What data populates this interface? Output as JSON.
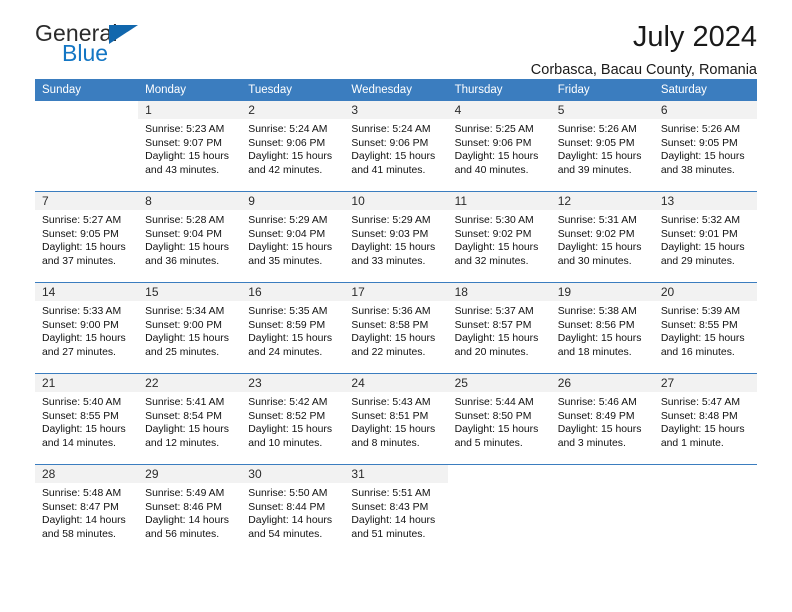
{
  "logo": {
    "word1": "General",
    "word2": "Blue",
    "triangle_color": "#1167ad",
    "blue_color": "#1376c4"
  },
  "header": {
    "title": "July 2024",
    "subtitle": "Corbasca, Bacau County, Romania"
  },
  "theme": {
    "header_bg": "#3b7dbf",
    "daynum_bg": "#f2f2f2",
    "grid_line": "#3b7dbf"
  },
  "weekdays": [
    "Sunday",
    "Monday",
    "Tuesday",
    "Wednesday",
    "Thursday",
    "Friday",
    "Saturday"
  ],
  "weeks": [
    [
      {
        "day": "",
        "sunrise": "",
        "sunset": "",
        "daylight1": "",
        "daylight2": ""
      },
      {
        "day": "1",
        "sunrise": "Sunrise: 5:23 AM",
        "sunset": "Sunset: 9:07 PM",
        "daylight1": "Daylight: 15 hours",
        "daylight2": "and 43 minutes."
      },
      {
        "day": "2",
        "sunrise": "Sunrise: 5:24 AM",
        "sunset": "Sunset: 9:06 PM",
        "daylight1": "Daylight: 15 hours",
        "daylight2": "and 42 minutes."
      },
      {
        "day": "3",
        "sunrise": "Sunrise: 5:24 AM",
        "sunset": "Sunset: 9:06 PM",
        "daylight1": "Daylight: 15 hours",
        "daylight2": "and 41 minutes."
      },
      {
        "day": "4",
        "sunrise": "Sunrise: 5:25 AM",
        "sunset": "Sunset: 9:06 PM",
        "daylight1": "Daylight: 15 hours",
        "daylight2": "and 40 minutes."
      },
      {
        "day": "5",
        "sunrise": "Sunrise: 5:26 AM",
        "sunset": "Sunset: 9:05 PM",
        "daylight1": "Daylight: 15 hours",
        "daylight2": "and 39 minutes."
      },
      {
        "day": "6",
        "sunrise": "Sunrise: 5:26 AM",
        "sunset": "Sunset: 9:05 PM",
        "daylight1": "Daylight: 15 hours",
        "daylight2": "and 38 minutes."
      }
    ],
    [
      {
        "day": "7",
        "sunrise": "Sunrise: 5:27 AM",
        "sunset": "Sunset: 9:05 PM",
        "daylight1": "Daylight: 15 hours",
        "daylight2": "and 37 minutes."
      },
      {
        "day": "8",
        "sunrise": "Sunrise: 5:28 AM",
        "sunset": "Sunset: 9:04 PM",
        "daylight1": "Daylight: 15 hours",
        "daylight2": "and 36 minutes."
      },
      {
        "day": "9",
        "sunrise": "Sunrise: 5:29 AM",
        "sunset": "Sunset: 9:04 PM",
        "daylight1": "Daylight: 15 hours",
        "daylight2": "and 35 minutes."
      },
      {
        "day": "10",
        "sunrise": "Sunrise: 5:29 AM",
        "sunset": "Sunset: 9:03 PM",
        "daylight1": "Daylight: 15 hours",
        "daylight2": "and 33 minutes."
      },
      {
        "day": "11",
        "sunrise": "Sunrise: 5:30 AM",
        "sunset": "Sunset: 9:02 PM",
        "daylight1": "Daylight: 15 hours",
        "daylight2": "and 32 minutes."
      },
      {
        "day": "12",
        "sunrise": "Sunrise: 5:31 AM",
        "sunset": "Sunset: 9:02 PM",
        "daylight1": "Daylight: 15 hours",
        "daylight2": "and 30 minutes."
      },
      {
        "day": "13",
        "sunrise": "Sunrise: 5:32 AM",
        "sunset": "Sunset: 9:01 PM",
        "daylight1": "Daylight: 15 hours",
        "daylight2": "and 29 minutes."
      }
    ],
    [
      {
        "day": "14",
        "sunrise": "Sunrise: 5:33 AM",
        "sunset": "Sunset: 9:00 PM",
        "daylight1": "Daylight: 15 hours",
        "daylight2": "and 27 minutes."
      },
      {
        "day": "15",
        "sunrise": "Sunrise: 5:34 AM",
        "sunset": "Sunset: 9:00 PM",
        "daylight1": "Daylight: 15 hours",
        "daylight2": "and 25 minutes."
      },
      {
        "day": "16",
        "sunrise": "Sunrise: 5:35 AM",
        "sunset": "Sunset: 8:59 PM",
        "daylight1": "Daylight: 15 hours",
        "daylight2": "and 24 minutes."
      },
      {
        "day": "17",
        "sunrise": "Sunrise: 5:36 AM",
        "sunset": "Sunset: 8:58 PM",
        "daylight1": "Daylight: 15 hours",
        "daylight2": "and 22 minutes."
      },
      {
        "day": "18",
        "sunrise": "Sunrise: 5:37 AM",
        "sunset": "Sunset: 8:57 PM",
        "daylight1": "Daylight: 15 hours",
        "daylight2": "and 20 minutes."
      },
      {
        "day": "19",
        "sunrise": "Sunrise: 5:38 AM",
        "sunset": "Sunset: 8:56 PM",
        "daylight1": "Daylight: 15 hours",
        "daylight2": "and 18 minutes."
      },
      {
        "day": "20",
        "sunrise": "Sunrise: 5:39 AM",
        "sunset": "Sunset: 8:55 PM",
        "daylight1": "Daylight: 15 hours",
        "daylight2": "and 16 minutes."
      }
    ],
    [
      {
        "day": "21",
        "sunrise": "Sunrise: 5:40 AM",
        "sunset": "Sunset: 8:55 PM",
        "daylight1": "Daylight: 15 hours",
        "daylight2": "and 14 minutes."
      },
      {
        "day": "22",
        "sunrise": "Sunrise: 5:41 AM",
        "sunset": "Sunset: 8:54 PM",
        "daylight1": "Daylight: 15 hours",
        "daylight2": "and 12 minutes."
      },
      {
        "day": "23",
        "sunrise": "Sunrise: 5:42 AM",
        "sunset": "Sunset: 8:52 PM",
        "daylight1": "Daylight: 15 hours",
        "daylight2": "and 10 minutes."
      },
      {
        "day": "24",
        "sunrise": "Sunrise: 5:43 AM",
        "sunset": "Sunset: 8:51 PM",
        "daylight1": "Daylight: 15 hours",
        "daylight2": "and 8 minutes."
      },
      {
        "day": "25",
        "sunrise": "Sunrise: 5:44 AM",
        "sunset": "Sunset: 8:50 PM",
        "daylight1": "Daylight: 15 hours",
        "daylight2": "and 5 minutes."
      },
      {
        "day": "26",
        "sunrise": "Sunrise: 5:46 AM",
        "sunset": "Sunset: 8:49 PM",
        "daylight1": "Daylight: 15 hours",
        "daylight2": "and 3 minutes."
      },
      {
        "day": "27",
        "sunrise": "Sunrise: 5:47 AM",
        "sunset": "Sunset: 8:48 PM",
        "daylight1": "Daylight: 15 hours",
        "daylight2": "and 1 minute."
      }
    ],
    [
      {
        "day": "28",
        "sunrise": "Sunrise: 5:48 AM",
        "sunset": "Sunset: 8:47 PM",
        "daylight1": "Daylight: 14 hours",
        "daylight2": "and 58 minutes."
      },
      {
        "day": "29",
        "sunrise": "Sunrise: 5:49 AM",
        "sunset": "Sunset: 8:46 PM",
        "daylight1": "Daylight: 14 hours",
        "daylight2": "and 56 minutes."
      },
      {
        "day": "30",
        "sunrise": "Sunrise: 5:50 AM",
        "sunset": "Sunset: 8:44 PM",
        "daylight1": "Daylight: 14 hours",
        "daylight2": "and 54 minutes."
      },
      {
        "day": "31",
        "sunrise": "Sunrise: 5:51 AM",
        "sunset": "Sunset: 8:43 PM",
        "daylight1": "Daylight: 14 hours",
        "daylight2": "and 51 minutes."
      },
      {
        "day": "",
        "sunrise": "",
        "sunset": "",
        "daylight1": "",
        "daylight2": ""
      },
      {
        "day": "",
        "sunrise": "",
        "sunset": "",
        "daylight1": "",
        "daylight2": ""
      },
      {
        "day": "",
        "sunrise": "",
        "sunset": "",
        "daylight1": "",
        "daylight2": ""
      }
    ]
  ]
}
